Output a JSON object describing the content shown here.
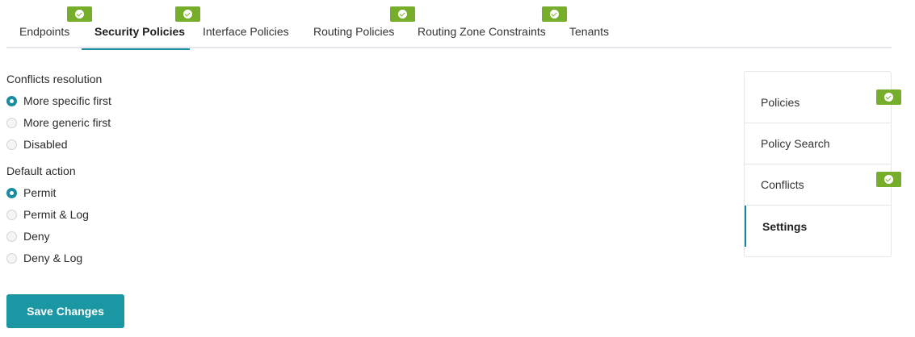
{
  "tabs": [
    {
      "label": "Endpoints",
      "has_badge": true,
      "active": false
    },
    {
      "label": "Security Policies",
      "has_badge": true,
      "active": true
    },
    {
      "label": "Interface Policies",
      "has_badge": false,
      "active": false
    },
    {
      "label": "Routing Policies",
      "has_badge": true,
      "active": false
    },
    {
      "label": "Routing Zone Constraints",
      "has_badge": true,
      "active": false
    },
    {
      "label": "Tenants",
      "has_badge": false,
      "active": false
    }
  ],
  "badge_icon": "check-circle-icon",
  "colors": {
    "accent": "#1a8ca0",
    "button": "#1a97a3",
    "badge": "#76ad2a",
    "side_active_border": "#1a7fa8"
  },
  "conflicts_resolution": {
    "label": "Conflicts resolution",
    "selected": "More specific first",
    "options": [
      "More specific first",
      "More generic first",
      "Disabled"
    ]
  },
  "default_action": {
    "label": "Default action",
    "selected": "Permit",
    "options": [
      "Permit",
      "Permit & Log",
      "Deny",
      "Deny & Log"
    ]
  },
  "save_button": {
    "label": "Save Changes"
  },
  "side_nav": {
    "items": [
      {
        "label": "Policies",
        "has_badge": true,
        "active": false
      },
      {
        "label": "Policy Search",
        "has_badge": false,
        "active": false
      },
      {
        "label": "Conflicts",
        "has_badge": true,
        "active": false
      },
      {
        "label": "Settings",
        "has_badge": false,
        "active": true
      }
    ]
  }
}
